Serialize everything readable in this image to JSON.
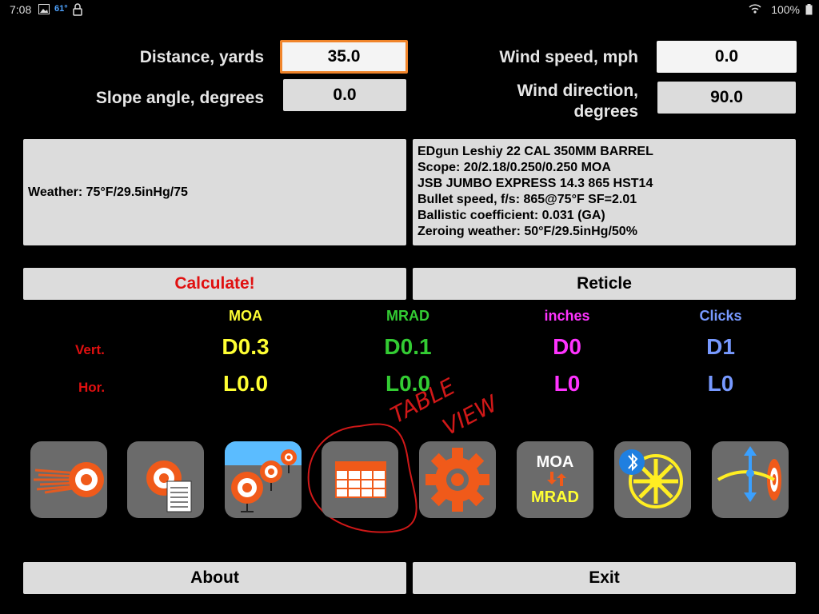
{
  "status": {
    "time": "7:08",
    "temp": "61°",
    "battery": "100%"
  },
  "inputs": {
    "distance_label": "Distance, yards",
    "distance_value": "35.0",
    "slope_label": "Slope angle, degrees",
    "slope_value": "0.0",
    "wind_speed_label": "Wind speed, mph",
    "wind_speed_value": "0.0",
    "wind_dir_label_1": "Wind direction,",
    "wind_dir_label_2": "degrees",
    "wind_dir_value": "90.0"
  },
  "weather_panel": {
    "text": "Weather: 75°F/29.5inHg/75"
  },
  "gun_panel": {
    "lines": [
      "EDgun Leshiy 22 CAL 350MM BARREL",
      "Scope: 20/2.18/0.250/0.250 MOA",
      "JSB JUMBO EXPRESS 14.3 865 HST14",
      "Bullet speed, f/s: 865@75°F SF=2.01",
      "Ballistic coefficient: 0.031 (GA)",
      "Zeroing weather: 50°F/29.5inHg/50%"
    ]
  },
  "buttons": {
    "calculate": "Calculate!",
    "reticle": "Reticle",
    "about": "About",
    "exit": "Exit"
  },
  "results": {
    "headers": [
      "MOA",
      "MRAD",
      "inches",
      "Clicks"
    ],
    "header_colors": [
      "#ffff33",
      "#33cc33",
      "#ff33ff",
      "#7799ff"
    ],
    "vert_label": "Vert.",
    "hor_label": "Hor.",
    "vert": [
      "D0.3",
      "D0.1",
      "D0",
      "D1"
    ],
    "hor": [
      "L0.0",
      "L0.0",
      "L0",
      "L0"
    ]
  },
  "annotation": {
    "text_1": "TABLE",
    "text_2": "VIEW",
    "color": "#d01818"
  },
  "toolbar": {
    "icons": [
      "trajectory-icon",
      "notes-icon",
      "multi-target-icon",
      "table-view-icon",
      "settings-icon",
      "moa-mrad-icon",
      "bluetooth-fan-icon",
      "zero-adjust-icon"
    ],
    "moa_text": "MOA",
    "mrad_text": "MRAD"
  }
}
